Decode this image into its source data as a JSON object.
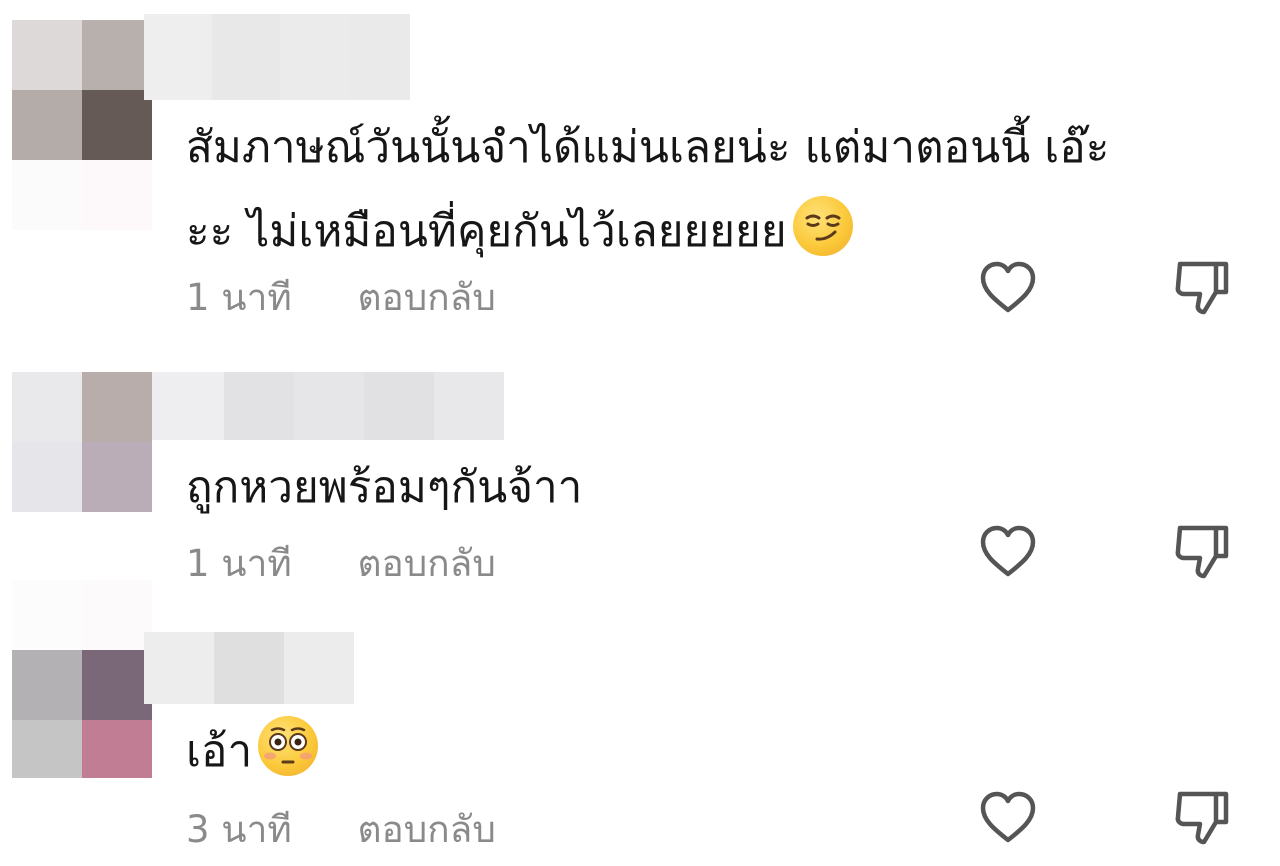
{
  "comments": [
    {
      "text_line1": "สัมภาษณ์วันนั้นจำได้แม่นเลยน่ะ แต่มาตอนนี้ เอ๊ะ",
      "text_line2": "ะะ ไม่เหมือนที่คุยกันไว้เลยยยยย",
      "emoji": "smirking-face",
      "time": "1 นาที",
      "reply": "ตอบกลับ"
    },
    {
      "text_line1": "ถูกหวยพร้อมๆกันจ้าา",
      "time": "1 นาที",
      "reply": "ตอบกลับ"
    },
    {
      "text_line1": "เอ้า",
      "emoji": "flushed-face",
      "time": "3 นาที",
      "reply": "ตอบกลับ"
    }
  ],
  "icons": {
    "like": "heart-outline-icon",
    "dislike": "thumbs-down-outline-icon"
  },
  "colors": {
    "text": "#161616",
    "meta": "#8a8a8a",
    "icon": "#555555"
  }
}
